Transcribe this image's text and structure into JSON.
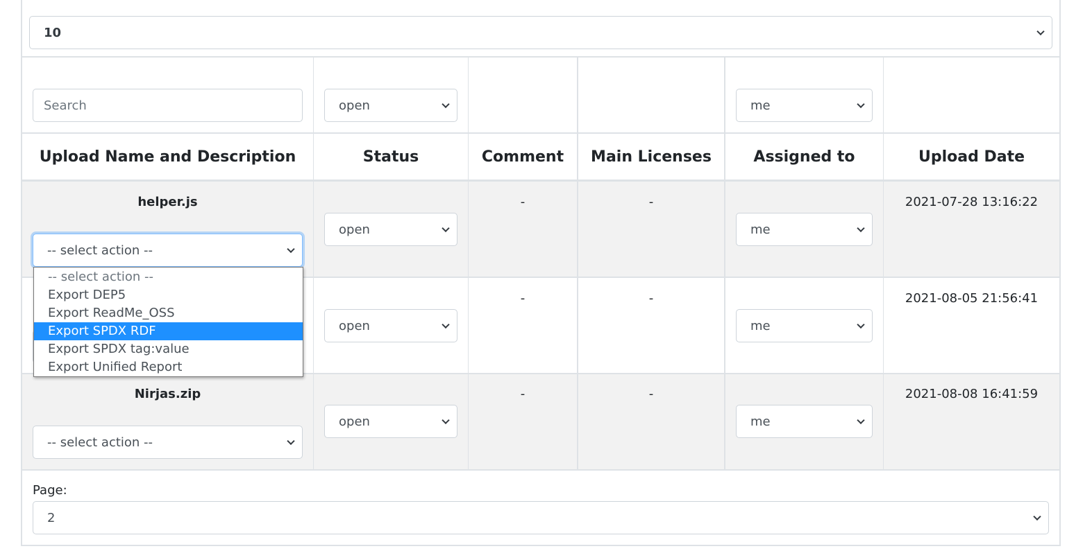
{
  "page_size": {
    "selected": "10"
  },
  "filters": {
    "search_placeholder": "Search",
    "status": "open",
    "assigned": "me"
  },
  "columns": [
    "Upload Name and Description",
    "Status",
    "Comment",
    "Main Licenses",
    "Assigned to",
    "Upload Date"
  ],
  "rows": [
    {
      "name": "helper.js",
      "action": "-- select action --",
      "status": "open",
      "comment": "-",
      "licenses": "-",
      "assigned": "me",
      "date": "2021-07-28 13:16:22"
    },
    {
      "name": "",
      "action": "-- select action --",
      "status": "open",
      "comment": "-",
      "licenses": "-",
      "assigned": "me",
      "date": "2021-08-05 21:56:41"
    },
    {
      "name": "Nirjas.zip",
      "action": "-- select action --",
      "status": "open",
      "comment": "-",
      "licenses": "-",
      "assigned": "me",
      "date": "2021-08-08 16:41:59"
    }
  ],
  "action_dropdown": {
    "options": [
      "-- select action --",
      "Export DEP5",
      "Export ReadMe_OSS",
      "Export SPDX RDF",
      "Export SPDX tag:value",
      "Export Unified Report"
    ],
    "highlighted": "Export SPDX RDF",
    "highlight_color": "#1e90ff"
  },
  "pagination": {
    "label": "Page:",
    "selected": "2"
  }
}
